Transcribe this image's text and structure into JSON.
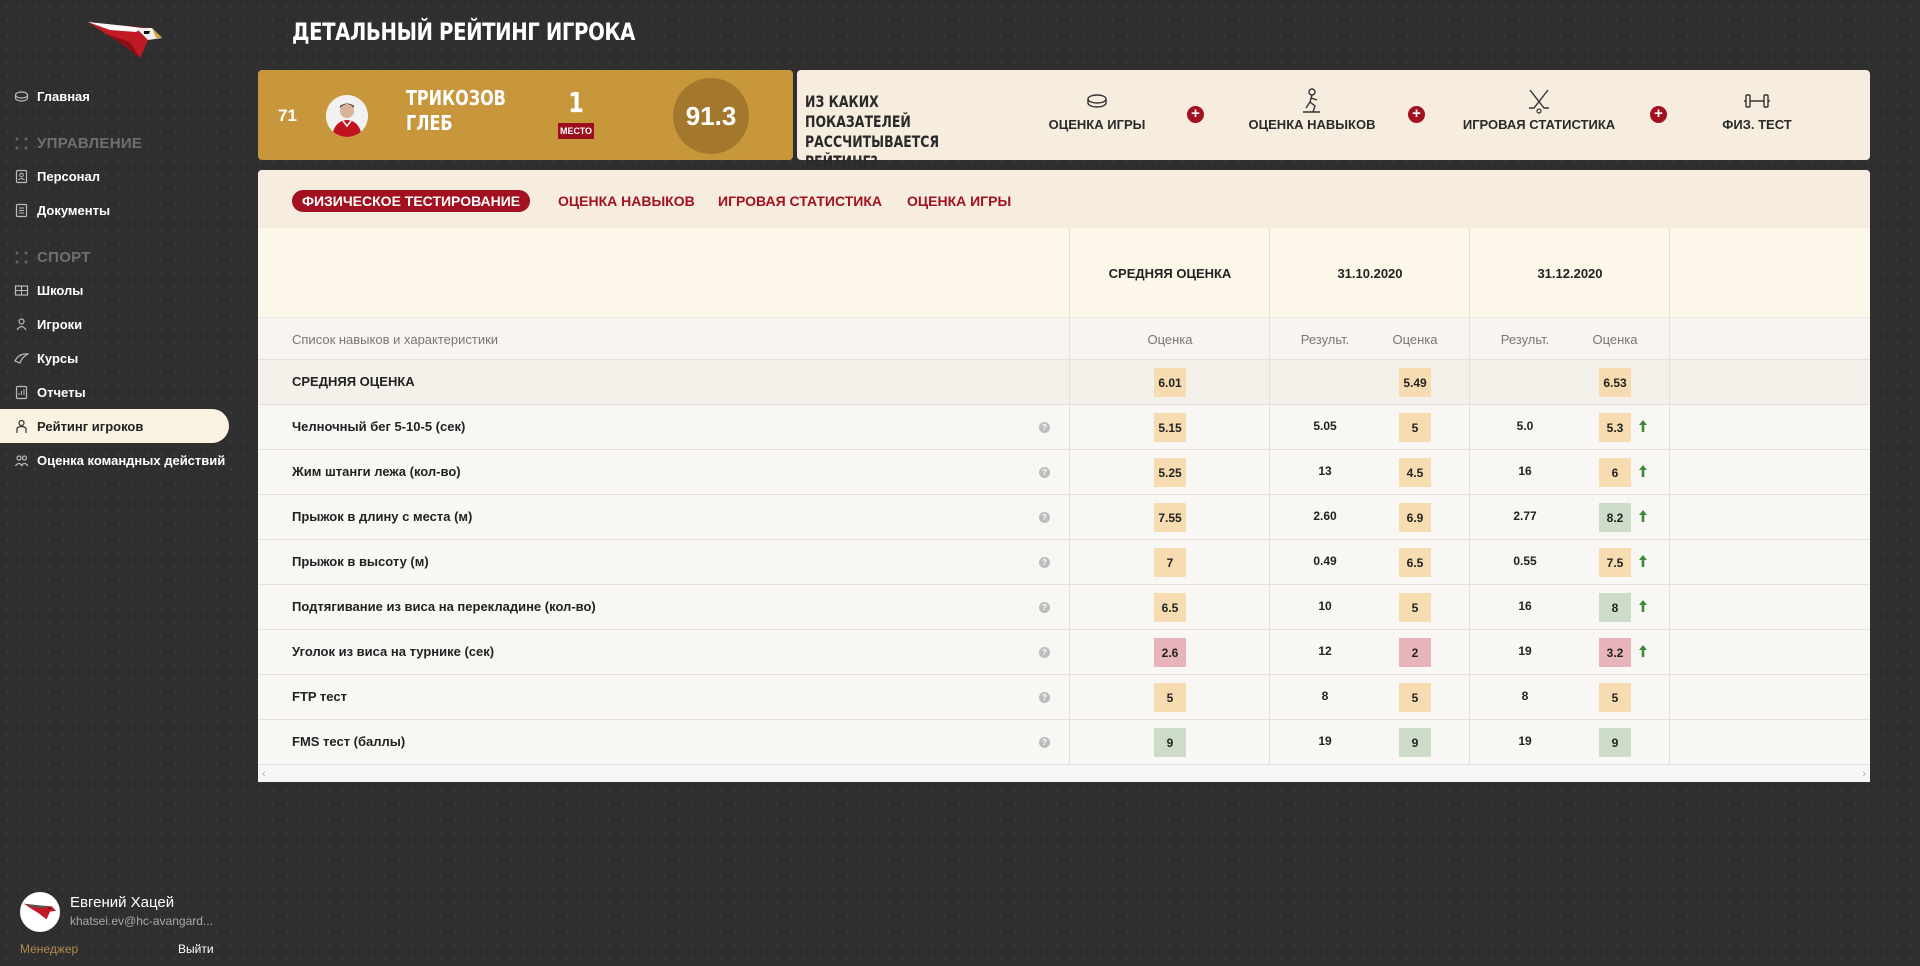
{
  "sidebar": {
    "items": [
      {
        "label": "Главная",
        "icon": "puck-icon"
      },
      {
        "label": "Персонал",
        "icon": "badge-icon"
      },
      {
        "label": "Документы",
        "icon": "document-icon"
      },
      {
        "label": "Школы",
        "icon": "school-icon"
      },
      {
        "label": "Игроки",
        "icon": "player-icon"
      },
      {
        "label": "Курсы",
        "icon": "courses-icon"
      },
      {
        "label": "Отчеты",
        "icon": "report-icon"
      },
      {
        "label": "Рейтинг игроков",
        "icon": "rating-icon"
      },
      {
        "label": "Оценка командных действий",
        "icon": "team-icon"
      }
    ],
    "sections": [
      "УПРАВЛЕНИЕ",
      "СПОРТ"
    ],
    "active_item": "Рейтинг игроков"
  },
  "user": {
    "name": "Евгений Хацей",
    "email": "khatsei.ev@hc-avangard...",
    "role": "Менеджер",
    "logout_label": "Выйти"
  },
  "page": {
    "title": "ДЕТАЛЬНЫЙ РЕЙТИНГ ИГРОКА"
  },
  "player": {
    "rank": "71",
    "first_line": "ТРИКОЗОВ",
    "second_line": "ГЛЕБ",
    "place": "1",
    "place_label": "место",
    "score": "91.3"
  },
  "rating_info": {
    "question": "ИЗ КАКИХ ПОКАЗАТЕЛЕЙ РАССЧИТЫВАЕТСЯ РЕЙТИНГ?",
    "items": [
      {
        "label": "ОЦЕНКА ИГРЫ",
        "icon": "puck-icon"
      },
      {
        "label": "ОЦЕНКА НАВЫКОВ",
        "icon": "skater-icon"
      },
      {
        "label": "ИГРОВАЯ СТАТИСТИКА",
        "icon": "crossed-sticks-icon"
      },
      {
        "label": "ФИЗ. ТЕСТ",
        "icon": "dumbbell-icon"
      }
    ],
    "plus_symbol": "+"
  },
  "tabs": [
    "ФИЗИЧЕСКОЕ ТЕСТИРОВАНИЕ",
    "ОЦЕНКА НАВЫКОВ",
    "ИГРОВАЯ СТАТИСТИКА",
    "ОЦЕНКА ИГРЫ"
  ],
  "active_tab": "ФИЗИЧЕСКОЕ ТЕСТИРОВАНИЕ",
  "table": {
    "column_headers": [
      "СРЕДНЯЯ ОЦЕНКА",
      "31.10.2020",
      "31.12.2020"
    ],
    "sub_headers": {
      "list": "Список навыков и характеристики",
      "avg": "Оценка",
      "result": "Результ.",
      "score": "Оценка"
    },
    "average_row": {
      "label": "СРЕДНЯЯ ОЦЕНКА",
      "avg": "6.01",
      "d1_score": "5.49",
      "d2_score": "6.53"
    },
    "help_symbol": "?",
    "rows": [
      {
        "label": "Челночный бег 5-10-5 (сек)",
        "avg": "5.15",
        "avg_level": "mid",
        "d1_result": "5.05",
        "d1_score": "5",
        "d1_level": "mid",
        "d2_result": "5.0",
        "d2_score": "5.3",
        "d2_level": "mid",
        "trend": "up"
      },
      {
        "label": "Жим штанги лежа (кол-во)",
        "avg": "5.25",
        "avg_level": "mid",
        "d1_result": "13",
        "d1_score": "4.5",
        "d1_level": "mid",
        "d2_result": "16",
        "d2_score": "6",
        "d2_level": "mid",
        "trend": "up"
      },
      {
        "label": "Прыжок в длину с места (м)",
        "avg": "7.55",
        "avg_level": "mid",
        "d1_result": "2.60",
        "d1_score": "6.9",
        "d1_level": "mid",
        "d2_result": "2.77",
        "d2_score": "8.2",
        "d2_level": "high",
        "trend": "up"
      },
      {
        "label": "Прыжок в высоту (м)",
        "avg": "7",
        "avg_level": "mid",
        "d1_result": "0.49",
        "d1_score": "6.5",
        "d1_level": "mid",
        "d2_result": "0.55",
        "d2_score": "7.5",
        "d2_level": "mid",
        "trend": "up"
      },
      {
        "label": "Подтягивание из виса на перекладине (кол-во)",
        "avg": "6.5",
        "avg_level": "mid",
        "d1_result": "10",
        "d1_score": "5",
        "d1_level": "mid",
        "d2_result": "16",
        "d2_score": "8",
        "d2_level": "high",
        "trend": "up"
      },
      {
        "label": "Уголок из виса на турнике (сек)",
        "avg": "2.6",
        "avg_level": "low",
        "d1_result": "12",
        "d1_score": "2",
        "d1_level": "low",
        "d2_result": "19",
        "d2_score": "3.2",
        "d2_level": "low",
        "trend": "up"
      },
      {
        "label": "FTP тест",
        "avg": "5",
        "avg_level": "mid",
        "d1_result": "8",
        "d1_score": "5",
        "d1_level": "mid",
        "d2_result": "8",
        "d2_score": "5",
        "d2_level": "mid",
        "trend": ""
      },
      {
        "label": "FMS тест (баллы)",
        "avg": "9",
        "avg_level": "high",
        "d1_result": "19",
        "d1_score": "9",
        "d1_level": "high",
        "d2_result": "19",
        "d2_score": "9",
        "d2_level": "high",
        "trend": ""
      }
    ]
  },
  "colors": {
    "accent_red": "#a3101f",
    "gold": "#c8973b",
    "level_mid": "#f6dcb0",
    "level_high": "#cddcc9",
    "level_low": "#e8b4bb",
    "trend_up": "#3e8a3a"
  },
  "scrollbar": {
    "left_arrow": "‹",
    "right_arrow": "›"
  }
}
